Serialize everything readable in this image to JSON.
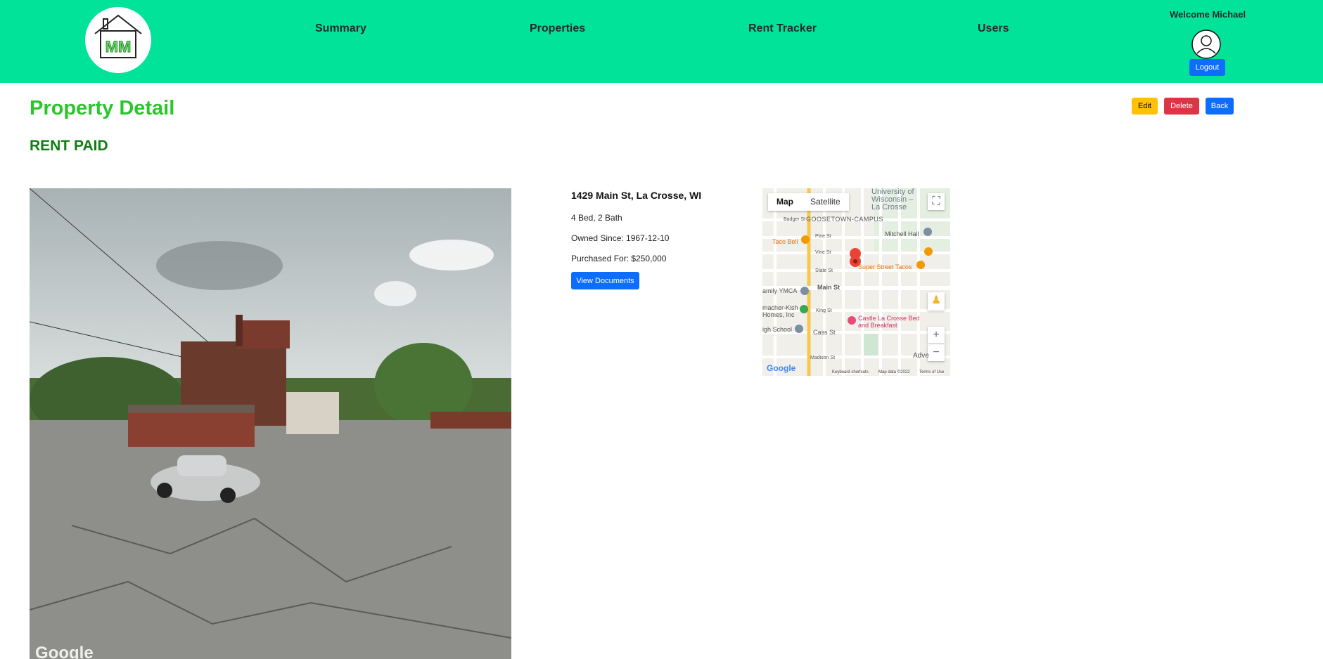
{
  "nav": {
    "logo_text": "MM",
    "links": [
      "Summary",
      "Properties",
      "Rent Tracker",
      "Users"
    ],
    "welcome": "Welcome Michael",
    "logout_label": "Logout"
  },
  "page": {
    "title": "Property Detail",
    "rent_status": "RENT PAID",
    "actions": {
      "edit": "Edit",
      "delete": "Delete",
      "back": "Back"
    }
  },
  "photo": {
    "watermark": "Google"
  },
  "property": {
    "address": "1429 Main St, La Crosse, WI",
    "beds_baths": "4 Bed, 2 Bath",
    "owned_since": "Owned Since: 1967-12-10",
    "purchased_for": "Purchased For: $250,000",
    "view_documents_label": "View Documents"
  },
  "map": {
    "tabs": [
      "Map",
      "Satellite"
    ],
    "labels": {
      "university": "University of Wisconsin –La Crosse",
      "neighborhood": "GOOSETOWN-CAMPUS",
      "mitchell": "Mitchell Hall",
      "taco_bell": "Taco Bell",
      "super_street": "Super Street Tacos",
      "main_st": "Main St",
      "ymca": "amily YMCA",
      "kish": "macher-Kish Homes, Inc",
      "castle": "Castle La Crosse Bed and Breakfast",
      "high_school": "igh School",
      "cass_st": "Cass St",
      "king_st": "King St",
      "state_st": "State St",
      "vine_st": "Vine St",
      "pine_st": "Pine St",
      "badger_st": "Badger St",
      "madison_st": "Madison St",
      "adv": "Adve"
    },
    "logo": "Google",
    "footer": [
      "Keyboard shortcuts",
      "Map data ©2022",
      "Terms of Use"
    ]
  }
}
